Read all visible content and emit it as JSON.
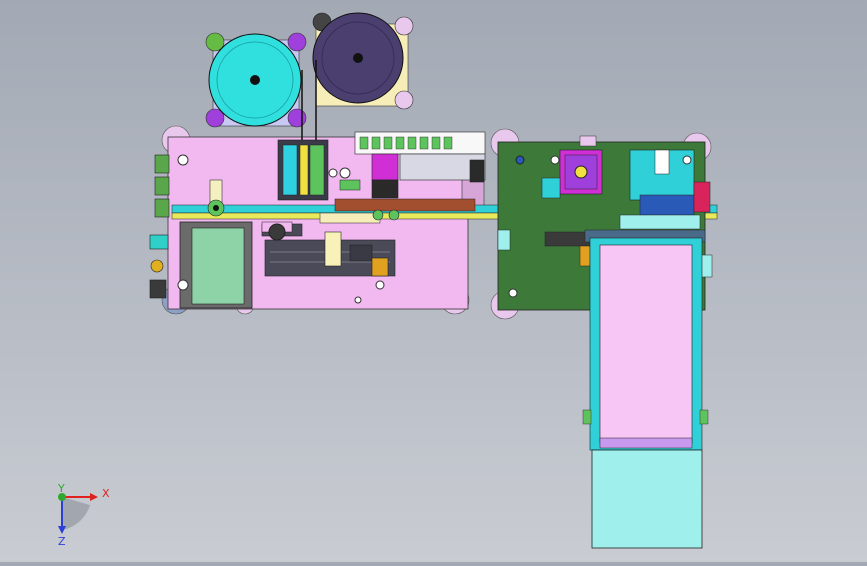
{
  "app": {
    "window_title": ""
  },
  "viewport": {
    "background_top": "#a3a9b4",
    "background_bottom": "#c9ccd2"
  },
  "axis_triad": {
    "x_label": "X",
    "y_label": "Y",
    "z_label": "Z",
    "x_color": "#e0201c",
    "y_color": "#2ea82e",
    "z_color": "#2a3fd6"
  },
  "model_colors": {
    "left_base": "#f2b8f0",
    "right_base": "#3d7a3a",
    "reel_cyan": "#2fe0de",
    "reel_dark": "#4a3f6e",
    "conveyor_pink": "#f7c6f4",
    "box_cyan": "#9ff0ec",
    "rail_yellow": "#e8ea5c",
    "magenta_part": "#d02fd6",
    "dark_block": "#4a4a58",
    "green_tank": "#8ed3a8"
  }
}
